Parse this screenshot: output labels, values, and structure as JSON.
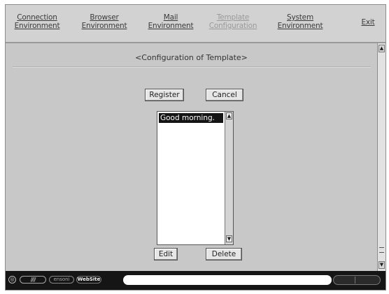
{
  "nav": {
    "items": [
      {
        "line1": "Connection",
        "line2": "Environment",
        "disabled": false
      },
      {
        "line1": "Browser",
        "line2": "Environment",
        "disabled": false
      },
      {
        "line1": "Mail",
        "line2": "Environment",
        "disabled": false
      },
      {
        "line1": "Template",
        "line2": "Configuration",
        "disabled": true
      },
      {
        "line1": "System",
        "line2": "Environment",
        "disabled": false
      }
    ],
    "exit": "Exit"
  },
  "page": {
    "title": "<Configuration of Template>",
    "register_label": "Register",
    "cancel_label": "Cancel",
    "edit_label": "Edit",
    "delete_label": "Delete"
  },
  "template_list": {
    "items": [
      "Good morning."
    ],
    "selected_index": 0
  },
  "status_bar": {
    "brand": "WebSite",
    "chip": "ensoni"
  },
  "colors": {
    "background": "#c8c8c8",
    "nav_text": "#3a3a3a",
    "nav_disabled": "#9a9a9a",
    "selection": "#141414",
    "status_bar": "#151515"
  }
}
